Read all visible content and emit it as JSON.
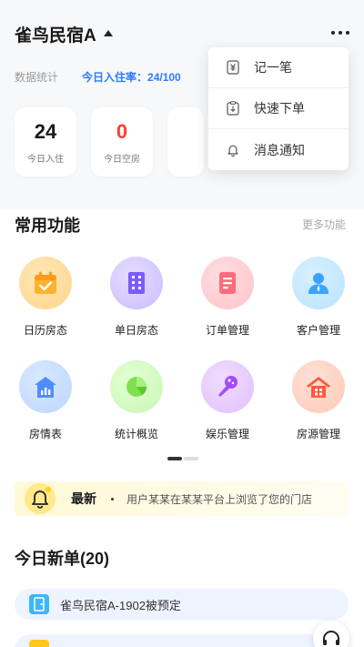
{
  "header": {
    "store_name": "雀鸟民宿A"
  },
  "stats": {
    "label": "数据统计",
    "occupancy": "今日入住率：24/100",
    "cards": [
      {
        "value": "24",
        "label": "今日入住",
        "color": "#1a1a1a"
      },
      {
        "value": "0",
        "label": "今日空房",
        "color": "#ff3b30"
      }
    ]
  },
  "menu": {
    "items": [
      {
        "label": "记一笔",
        "icon": "yuan-note-icon"
      },
      {
        "label": "快速下单",
        "icon": "quick-order-icon"
      },
      {
        "label": "消息通知",
        "icon": "bell-icon"
      }
    ]
  },
  "functions": {
    "title": "常用功能",
    "more": "更多功能",
    "items": [
      {
        "label": "日历房态",
        "icon": "calendar-icon"
      },
      {
        "label": "单日房态",
        "icon": "building-icon"
      },
      {
        "label": "订单管理",
        "icon": "order-list-icon"
      },
      {
        "label": "客户管理",
        "icon": "customer-icon"
      },
      {
        "label": "房情表",
        "icon": "room-chart-icon"
      },
      {
        "label": "统计概览",
        "icon": "pie-chart-icon"
      },
      {
        "label": "娱乐管理",
        "icon": "microphone-icon"
      },
      {
        "label": "房源管理",
        "icon": "house-icon"
      }
    ]
  },
  "notice": {
    "tag": "最新",
    "text": "用户某某在某某平台上浏览了您的门店"
  },
  "new_orders": {
    "title": "今日新单(20)",
    "items": [
      {
        "text": "雀鸟民宿A-1902被预定"
      }
    ]
  },
  "colors": {
    "accent": "#2b7bff",
    "danger": "#ff3b30",
    "page_bg": "#f7f8fa"
  }
}
